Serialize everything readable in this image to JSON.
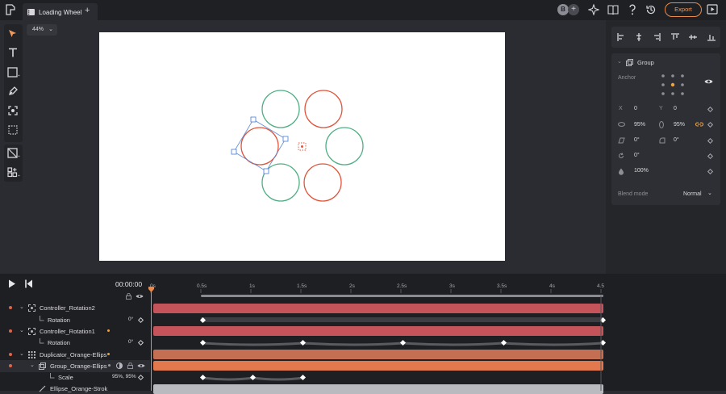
{
  "tab": {
    "title": "Loading Wheel"
  },
  "header": {
    "avatar_initial": "B",
    "export_label": "Export"
  },
  "canvas": {
    "zoom": "44%"
  },
  "panel": {
    "group_title": "Group",
    "anchor_label": "Anchor",
    "x_label": "X",
    "x_value": "0",
    "y_label": "Y",
    "y_value": "0",
    "width_value": "95%",
    "height_value": "95%",
    "skew_value": "0°",
    "corner_value": "0°",
    "rotation_value": "0°",
    "opacity_value": "100%",
    "blend_label": "Blend mode",
    "blend_value": "Normal"
  },
  "timeline": {
    "timecode": "00:00:00",
    "ticks": [
      "0s",
      "0.5s",
      "1s",
      "1.5s",
      "2s",
      "2.5s",
      "3s",
      "3.5s",
      "4s",
      "4.5"
    ],
    "layers": [
      {
        "name": "Controller_Rotation2",
        "value": ""
      },
      {
        "name": "Rotation",
        "value": "0°"
      },
      {
        "name": "Controller_Rotation1",
        "value": ""
      },
      {
        "name": "Rotation",
        "value": "0°"
      },
      {
        "name": "Duplicator_Orange-Ellips",
        "value": ""
      },
      {
        "name": "Group_Orange-Ellips",
        "value": ""
      },
      {
        "name": "Scale",
        "value": "95%, 95%"
      },
      {
        "name": "Ellipse_Orange-Strok",
        "value": ""
      }
    ]
  },
  "colors": {
    "accent": "#e98a49",
    "orange_stroke": "#e0533a",
    "green_stroke": "#4fae84",
    "selection": "#5b8ad6",
    "bar_red": "#c4545a",
    "bar_orange": "#c46e52"
  }
}
